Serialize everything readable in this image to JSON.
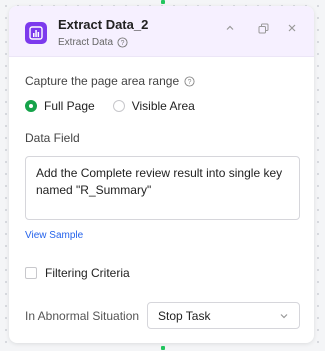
{
  "node": {
    "title": "Extract Data_2",
    "subtitle": "Extract Data",
    "icon": "chart-box-icon",
    "accent_color": "#7c3aed"
  },
  "capture": {
    "label": "Capture the page area range",
    "options": [
      {
        "label": "Full Page",
        "checked": true
      },
      {
        "label": "Visible Area",
        "checked": false
      }
    ]
  },
  "data_field": {
    "label": "Data Field",
    "value": "Add the Complete review result into single key named \"R_Summary\""
  },
  "view_sample": "View Sample",
  "filtering": {
    "label": "Filtering Criteria",
    "checked": false
  },
  "abnormal": {
    "label": "In Abnormal Situation",
    "selected": "Stop Task"
  },
  "colors": {
    "selected_radio": "#16a34a",
    "link": "#2563eb",
    "connector": "#22c55e"
  }
}
